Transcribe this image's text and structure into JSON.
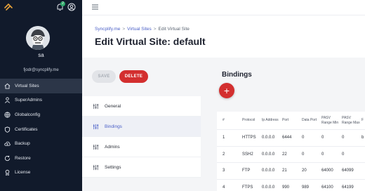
{
  "sidebar": {
    "user": {
      "name": "sa",
      "email": "fjodr@syncplify.me"
    },
    "notifications_badge": "2",
    "items": [
      {
        "label": "Virtual Sites",
        "icon": "home-icon",
        "active": true
      },
      {
        "label": "SuperAdmins",
        "icon": "person-icon",
        "active": false
      },
      {
        "label": "Globalconfig",
        "icon": "globe-icon",
        "active": false
      },
      {
        "label": "Certificates",
        "icon": "shield-icon",
        "active": false
      },
      {
        "label": "Backup",
        "icon": "cloud-upload-icon",
        "active": false
      },
      {
        "label": "Restore",
        "icon": "refresh-icon",
        "active": false
      },
      {
        "label": "License",
        "icon": "license-icon",
        "active": false
      }
    ]
  },
  "breadcrumb": {
    "root": "Syncplify.me",
    "section": "Virtual Sites",
    "current": "Edit Virtual Site"
  },
  "page": {
    "title": "Edit Virtual Site: default"
  },
  "actions": {
    "save": "SAVE",
    "delete": "DELETE"
  },
  "tabs": [
    {
      "label": "General",
      "active": false
    },
    {
      "label": "Bindings",
      "active": true
    },
    {
      "label": "Admins",
      "active": false
    },
    {
      "label": "Settings",
      "active": false
    }
  ],
  "bindings": {
    "title": "Bindings",
    "add_label": "+",
    "columns": [
      "#",
      "Protocol",
      "Ip Address",
      "Port",
      "Data Port",
      "PASV Range Min",
      "PASV Range Max",
      "F"
    ],
    "rows": [
      [
        "1",
        "HTTPS",
        "0.0.0.0",
        "6444",
        "0",
        "0",
        "0",
        "b"
      ],
      [
        "2",
        "SSH2",
        "0.0.0.0",
        "22",
        "0",
        "0",
        "0",
        ""
      ],
      [
        "3",
        "FTP",
        "0.0.0.0",
        "21",
        "20",
        "64000",
        "64099",
        ""
      ],
      [
        "4",
        "FTPS",
        "0.0.0.0",
        "990",
        "989",
        "64100",
        "64199",
        ""
      ]
    ]
  },
  "colors": {
    "sidebar_bg": "#111a2b",
    "accent": "#4a5fc7",
    "danger": "#d32f2f",
    "badge": "#2ea96a"
  }
}
